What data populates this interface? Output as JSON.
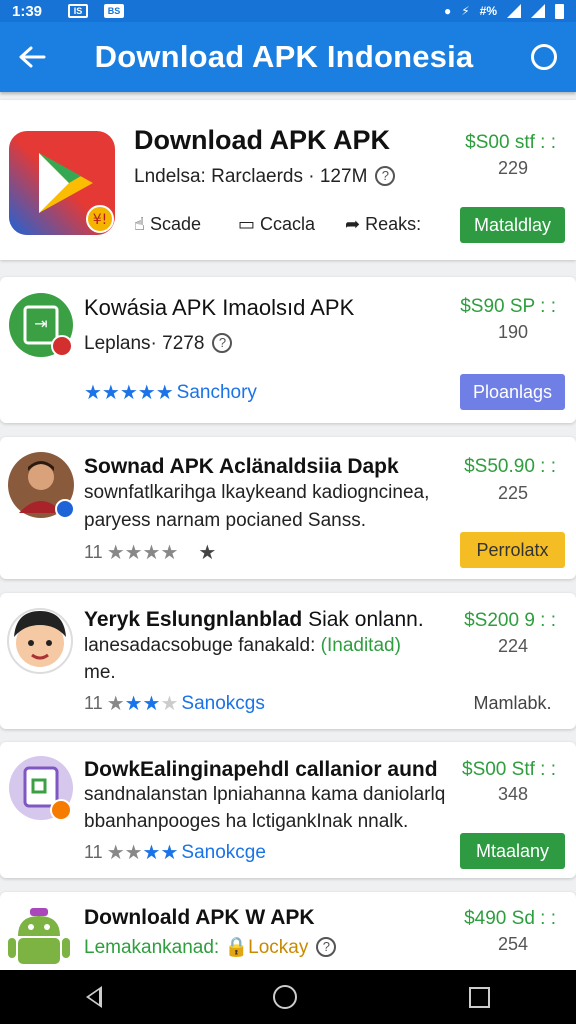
{
  "status": {
    "time": "1:39",
    "box1": "IS",
    "box2": "BS",
    "net": "#%"
  },
  "appbar": {
    "title": "Download APK Indonesia"
  },
  "cards": [
    {
      "name": "Download APK APK",
      "subtitle": "Lndelsa: Rarclaerds · 127M",
      "price": "$S00 stf : :",
      "count": "229",
      "actions": [
        "Scade",
        "Ccacla",
        "Reaks:"
      ],
      "button": "Mataldlay"
    },
    {
      "name": "Kowásia APK Imaolsıd APK",
      "subtitle": "Leplans· 7278",
      "price": "$S90 SP : :",
      "count": "190",
      "rating_label": "Sanchory",
      "button": "Ploanlags"
    },
    {
      "name": "Sownad APK Aclänaldsiia Dapk",
      "desc1": "sownfatlkarihga lkaykeand kadiogncinea,",
      "desc2": "paryess narnam pocianed Sanss.",
      "rating_count": "11",
      "price": "$S50.90 : :",
      "count": "225",
      "button": "Perrolatx"
    },
    {
      "name": "Yeryk Eslungnlanblad",
      "name_rest": "Siak onlann.",
      "desc1": "lanesadacsobuge fanakald:",
      "desc1_highlight": "(Inaditad)",
      "desc2": "me.",
      "rating_count": "11",
      "rating_label": "Sanokcgs",
      "price": "$S200 9 : :",
      "count": "224",
      "button": "Mamlabk."
    },
    {
      "name": "DowkEalinginapehdl callanior aund",
      "desc1": "sandnalanstan lpniahanna kama daniolarlq",
      "desc2": "bbanhanpooges ha lctigankInak nnalk.",
      "rating_count": "11",
      "rating_label": "Sanokcge",
      "price": "$S00 Stf : :",
      "count": "348",
      "button": "Mtaalany"
    },
    {
      "name": "Downloald APK W APK",
      "subtitle": "Lemakankanad:",
      "subtitle_badge": "Lockay",
      "price": "$490 Sd : :",
      "count": "254"
    }
  ],
  "colors": {
    "appbar": "#1a7fe0",
    "green": "#2e9a42",
    "purple": "#6f7fe6",
    "yellow": "#f4bd24",
    "star": "#1a73e8"
  }
}
